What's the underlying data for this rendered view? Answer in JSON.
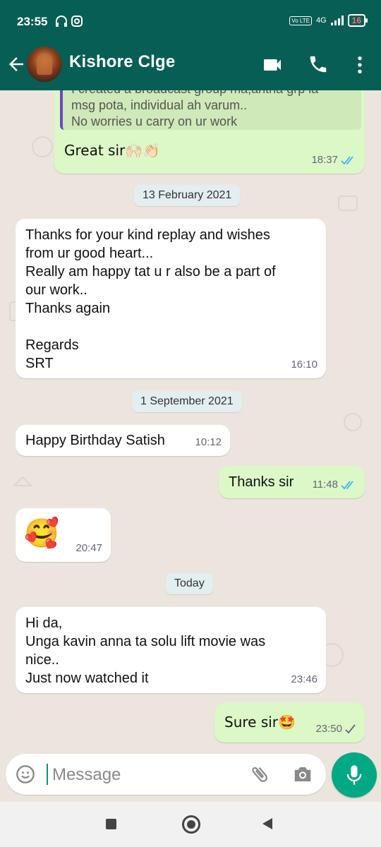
{
  "status_bar": {
    "time": "23:55",
    "volte": "Vo LTE",
    "network": "4G",
    "battery": "16"
  },
  "header": {
    "contact_name": "Kishore Clge"
  },
  "messages": {
    "quote_line1": "I created a broadcast group ma,antha grp la",
    "quote_line2": "msg pota, individual ah varum..",
    "quote_line3": "No worries u carry on ur work",
    "m1_text": "Great sir🙌🏻👏🏻",
    "m1_time": "18:37",
    "date1": "13 February 2021",
    "m2_line1": "Thanks for your kind replay and wishes",
    "m2_line2": "from ur good heart...",
    "m2_line3": "Really am happy tat u r also be a part of",
    "m2_line4": "our work..",
    "m2_line5": "Thanks again",
    "m2_line6": "Regards",
    "m2_line7": "SRT",
    "m2_time": "16:10",
    "date2": "1 September 2021",
    "m3_text": "Happy Birthday Satish",
    "m3_time": "10:12",
    "m4_text": "Thanks sir",
    "m4_time": "11:48",
    "m5_emoji": "🥰",
    "m5_time": "20:47",
    "date3": "Today",
    "m6_line1": "Hi da,",
    "m6_line2": "Unga kavin anna ta solu lift movie was",
    "m6_line3": "nice..",
    "m6_line4": "Just now watched it",
    "m6_time": "23:46",
    "m7_text": "Sure sir🤩",
    "m7_time": "23:50"
  },
  "input": {
    "placeholder": "Message"
  },
  "colors": {
    "header": "#075e54",
    "outgoing_bubble": "#dcf8c6",
    "incoming_bubble": "#ffffff",
    "read_tick": "#34b7f1",
    "mic_button": "#00a884"
  }
}
